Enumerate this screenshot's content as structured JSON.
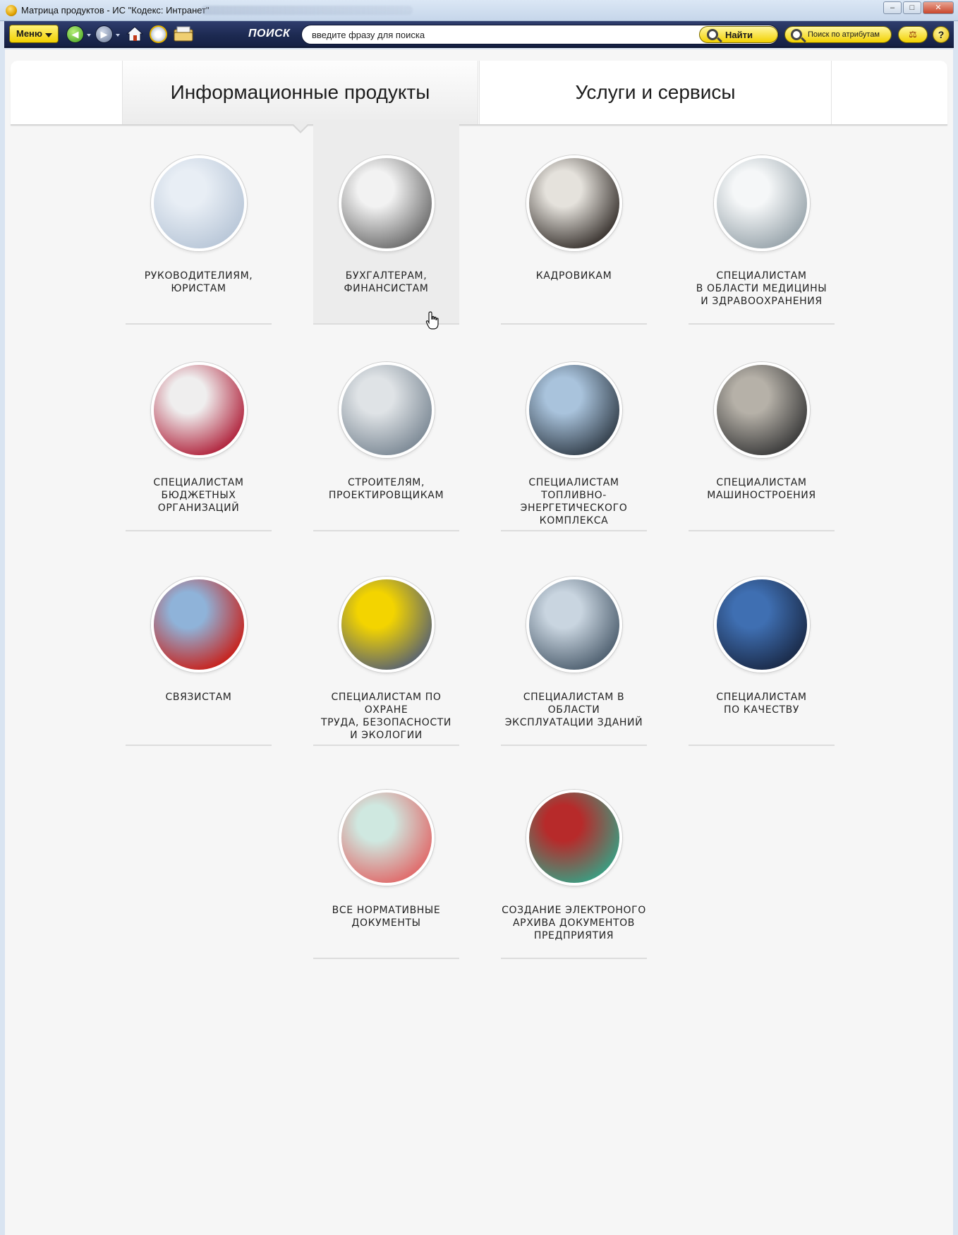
{
  "window": {
    "title": "Матрица продуктов - ИС \"Кодекс: Интранет\"",
    "controls": {
      "minimize": "–",
      "maximize": "□",
      "close": "✕"
    }
  },
  "toolbar": {
    "menu_label": "Меню",
    "search_label": "ПОИСК",
    "search_placeholder": "введите фразу для поиска",
    "find_label": "Найти",
    "attr_search_label": "Поиск по атрибутам",
    "scales_glyph": "⚖",
    "help_label": "?",
    "nav_back_glyph": "◀",
    "nav_fwd_glyph": "▶"
  },
  "tabs": [
    {
      "label": "Информационные продукты",
      "active": true
    },
    {
      "label": "Услуги и сервисы",
      "active": false
    }
  ],
  "cards": [
    {
      "label": "РУКОВОДИТЕЛИЯМ,\nЮРИСТАМ",
      "icon": "handshake-document-photo",
      "colors": [
        "#e8eef5",
        "#b9c7d8"
      ]
    },
    {
      "label": "БУХГАЛТЕРАМ,\nФИНАНСИСТАМ",
      "icon": "calculator-photo",
      "colors": [
        "#f2f2f2",
        "#6f6f6f"
      ],
      "hover": true
    },
    {
      "label": "КАДРОВИКАМ",
      "icon": "office-people-photo",
      "colors": [
        "#e5e2dc",
        "#3a3430"
      ]
    },
    {
      "label": "СПЕЦИАЛИСТАМ\nВ ОБЛАСТИ МЕДИЦИНЫ\nИ ЗДРАВООХРАНЕНИЯ",
      "icon": "doctor-clipboard-photo",
      "colors": [
        "#f5f7f8",
        "#9aa6ad"
      ]
    },
    {
      "label": "СПЕЦИАЛИСТАМ\nБЮДЖЕТНЫХ\nОРГАНИЗАЦИЙ",
      "icon": "handshake-photo",
      "colors": [
        "#efeeee",
        "#b0233c"
      ]
    },
    {
      "label": "СТРОИТЕЛЯМ,\nПРОЕКТИРОВЩИКАМ",
      "icon": "builder-photo",
      "colors": [
        "#dfe3e6",
        "#7d8a96"
      ]
    },
    {
      "label": "СПЕЦИАЛИСТАМ ТОПЛИВНО-\nЭНЕРГЕТИЧЕСКОГО\nКОМПЛЕКСА",
      "icon": "engineer-helmet-photo",
      "colors": [
        "#a9c3dc",
        "#34404c"
      ]
    },
    {
      "label": "СПЕЦИАЛИСТАМ\nМАШИНОСТРОЕНИЯ",
      "icon": "machinist-photo",
      "colors": [
        "#b6b1a8",
        "#3b3b3b"
      ]
    },
    {
      "label": "СВЯЗИСТАМ",
      "icon": "radio-worker-photo",
      "colors": [
        "#8fb3d9",
        "#c8201a"
      ]
    },
    {
      "label": "СПЕЦИАЛИСТАМ ПО ОХРАНЕ\nТРУДА, БЕЗОПАСНОСТИ\nИ ЭКОЛОГИИ",
      "icon": "safety-helmet-photo",
      "colors": [
        "#f3d400",
        "#5b6470"
      ]
    },
    {
      "label": "СПЕЦИАЛИСТАМ В ОБЛАСТИ\nЭКСПЛУАТАЦИИ ЗДАНИЙ",
      "icon": "buildings-photo",
      "colors": [
        "#c9d5e0",
        "#4f6070"
      ]
    },
    {
      "label": "СПЕЦИАЛИСТАМ\nПО КАЧЕСТВУ",
      "icon": "quality-handshake-photo",
      "colors": [
        "#3f6fb2",
        "#1a2a48"
      ]
    },
    {
      "label": "ВСЕ НОРМАТИВНЫЕ\nДОКУМЕНТЫ",
      "icon": "documents-stack-photo",
      "colors": [
        "#cfe8e0",
        "#e06a6a"
      ]
    },
    {
      "label": "СОЗДАНИЕ ЭЛЕКТРОНОГО\nАРХИВА ДОКУМЕНТОВ\nПРЕДПРИЯТИЯ",
      "icon": "binders-photo",
      "colors": [
        "#b72a2a",
        "#3a9e82"
      ]
    }
  ]
}
